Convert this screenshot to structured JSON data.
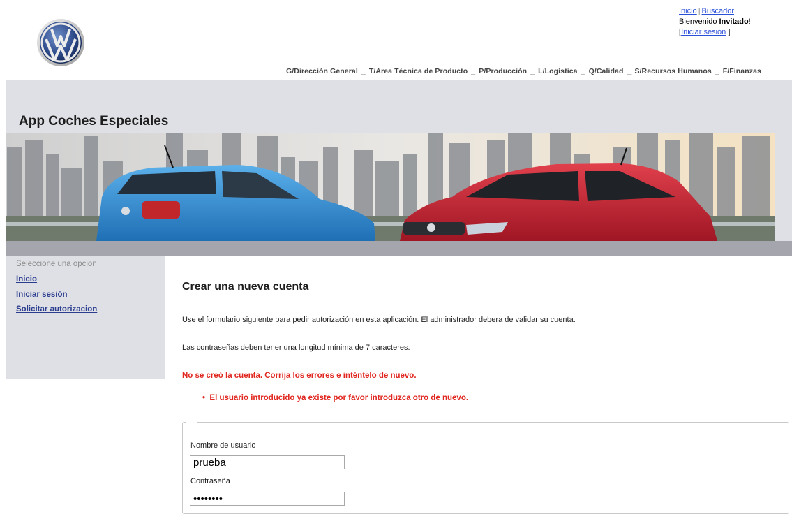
{
  "header": {
    "link_home": "Inicio",
    "link_separator": "|",
    "link_search": "Buscador",
    "welcome_prefix": "Bienvenido ",
    "welcome_user": "Invitado",
    "welcome_suffix": "!",
    "login_open": "[",
    "login_link": "Iniciar sesión",
    "login_close": " ]"
  },
  "topnav": {
    "items": [
      "G/Dirección General",
      "T/Area Técnica de Producto",
      "P/Producción",
      "L/Logística",
      "Q/Calidad",
      "S/Recursos Humanos",
      "F/Finanzas"
    ],
    "separator": "_"
  },
  "app_title": "App Coches Especiales",
  "sidebar": {
    "heading": "Seleccione una opcion",
    "items": [
      {
        "label": "Inicio"
      },
      {
        "label": "Iniciar sesión"
      },
      {
        "label": "Solicitar autorizacion"
      }
    ]
  },
  "main": {
    "title": "Crear una nueva cuenta",
    "intro": "Use el formulario siguiente para pedir autorización en esta aplicación. El administrador debera de validar su cuenta.",
    "password_rule": "Las contraseñas deben tener una longitud mínima de 7 caracteres.",
    "error_title": "No se creó la cuenta. Corrija los errores e inténtelo de nuevo.",
    "errors": [
      "El usuario introducido ya existe por favor introduzca otro de nuevo."
    ],
    "form": {
      "username_label": "Nombre de usuario",
      "username_value": "prueba",
      "password_label": "Contraseña",
      "password_value": "prueba12"
    }
  },
  "colors": {
    "panel_gray": "#dfe0e5",
    "strip_gray": "#a4a5ad",
    "error_red": "#e0261e",
    "link_blue": "#2a4fd8",
    "nav_link": "#2b3d8f",
    "car_blue": "#2f8fd6",
    "car_red": "#c8202e"
  },
  "icons": {
    "logo": "vw-logo-icon",
    "bullet": "bullet-icon"
  }
}
